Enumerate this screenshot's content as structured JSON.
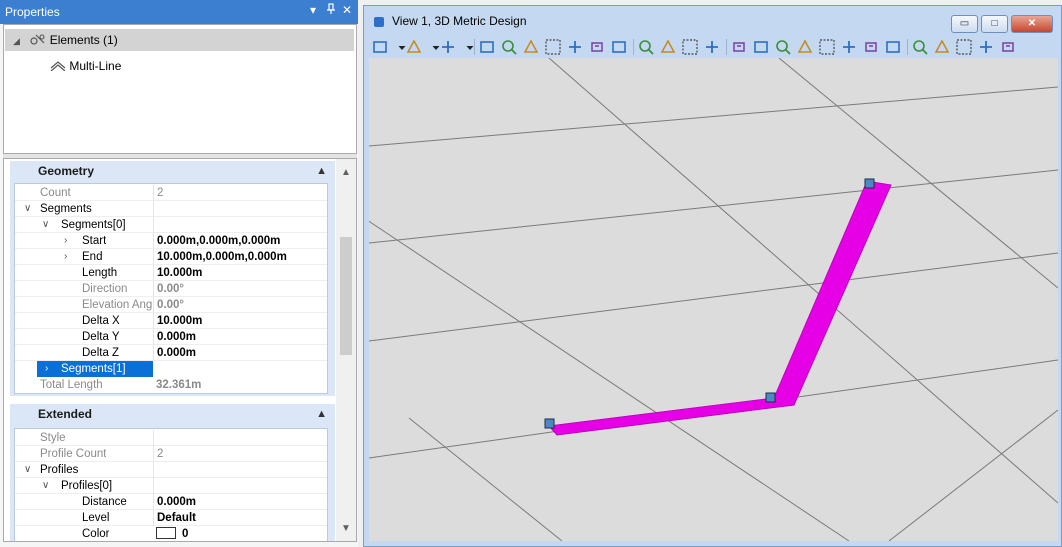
{
  "properties_panel": {
    "title": "Properties",
    "controls": {
      "dropdown": "▾",
      "pin": "ᵖ",
      "close": "✕"
    },
    "tree": {
      "root_label": "Elements (1)",
      "child_label": "Multi-Line"
    },
    "geometry": {
      "header": "Geometry",
      "rows": {
        "count_label": "Count",
        "count_value": "2",
        "segments_label": "Segments",
        "segments0_label": "Segments[0]",
        "start_label": "Start",
        "start_value": "0.000m,0.000m,0.000m",
        "end_label": "End",
        "end_value": "10.000m,0.000m,0.000m",
        "length_label": "Length",
        "length_value": "10.000m",
        "direction_label": "Direction",
        "direction_value": "0.00°",
        "elevation_label": "Elevation Ang",
        "elevation_value": "0.00°",
        "deltax_label": "Delta X",
        "deltax_value": "10.000m",
        "deltay_label": "Delta Y",
        "deltay_value": "0.000m",
        "deltaz_label": "Delta Z",
        "deltaz_value": "0.000m",
        "segments1_label": "Segments[1]",
        "total_label": "Total Length",
        "total_value": "32.361m"
      }
    },
    "extended": {
      "header": "Extended",
      "rows": {
        "style_label": "Style",
        "profile_count_label": "Profile Count",
        "profile_count_value": "2",
        "profiles_label": "Profiles",
        "profiles0_label": "Profiles[0]",
        "distance_label": "Distance",
        "distance_value": "0.000m",
        "level_label": "Level",
        "level_value": "Default",
        "color_label": "Color",
        "color_value": "0"
      }
    }
  },
  "view_window": {
    "title": "View 1, 3D Metric Design",
    "window_controls": {
      "minimize": "▭",
      "maximize": "□",
      "close": "✕"
    },
    "multiline_color": "#e600e6",
    "toolbar_icons": [
      "view-attributes-icon",
      "dropdown-arrow-icon",
      "display-style-icon",
      "dropdown-arrow-icon",
      "lighting-icon",
      "dropdown-arrow-icon",
      "update-view-icon",
      "zoom-in-icon",
      "zoom-out-icon",
      "window-area-icon",
      "fit-view-icon",
      "rotate-view-icon",
      "pan-view-icon",
      "walk-icon",
      "view-previous-icon",
      "view-next-icon",
      "copy-view-icon",
      "clip-volume-icon",
      "clip-mask-icon",
      "camera-icon",
      "view-toggles-icon",
      "save-view-icon",
      "depth-icon",
      "set-display-depth-icon",
      "active-depth-icon",
      "view-undo-icon",
      "screenshot-icon",
      "3d-cube-icon",
      "tools-icon",
      "help-icon"
    ]
  }
}
